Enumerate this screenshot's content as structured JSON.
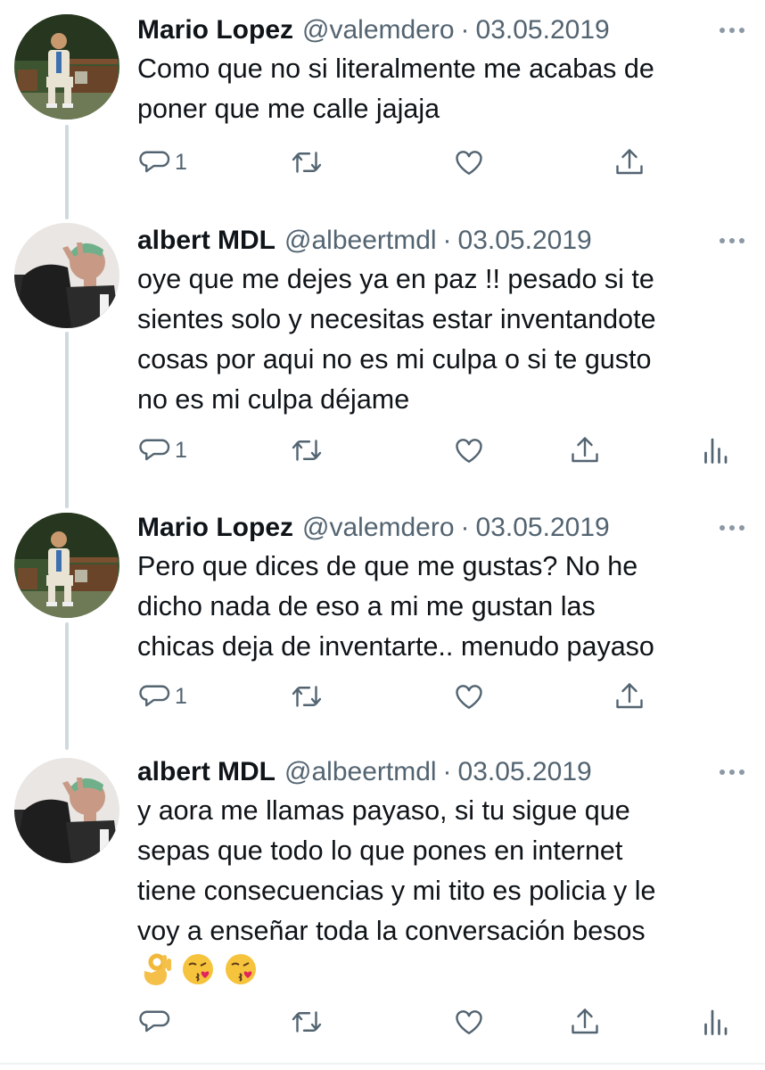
{
  "tweets": [
    {
      "name": "Mario Lopez",
      "handle": "@valemdero",
      "separator": "·",
      "date": "03.05.2019",
      "lines": [
        "Como que no si literalmente me acabas de",
        "poner que me calle jajaja"
      ],
      "reply_count": "1",
      "avatar_icon": "avatar-man-on-bench"
    },
    {
      "name": "albert MDL",
      "handle": "@albeertmdl",
      "separator": "·",
      "date": "03.05.2019",
      "lines": [
        "oye que me dejes ya en paz !! pesado si te",
        "sientes solo y necesitas estar inventandote",
        "cosas por aqui no es mi culpa o si te gusto",
        "no es mi culpa déjame"
      ],
      "reply_count": "1",
      "avatar_icon": "avatar-person-green-hair"
    },
    {
      "name": "Mario Lopez",
      "handle": "@valemdero",
      "separator": "·",
      "date": "03.05.2019",
      "lines": [
        "Pero que dices de que me gustas? No he",
        "dicho nada de eso a mi me gustan las",
        "chicas deja de inventarte.. menudo payaso"
      ],
      "reply_count": "1",
      "avatar_icon": "avatar-man-on-bench"
    },
    {
      "name": "albert MDL",
      "handle": "@albeertmdl",
      "separator": "·",
      "date": "03.05.2019",
      "lines": [
        "y aora me llamas payaso, si tu sigue que",
        "sepas que todo lo que pones en internet",
        "tiene consecuencias y mi tito es policia y le",
        "voy a enseñar toda la conversación besos"
      ],
      "emojis": [
        "👌",
        "😘",
        "😘"
      ],
      "reply_count": "",
      "avatar_icon": "avatar-person-green-hair"
    }
  ],
  "icons": {
    "more": "more-horizontal-icon",
    "reply": "reply-icon",
    "retweet": "retweet-icon",
    "like": "heart-icon",
    "share": "share-icon",
    "stats": "analytics-icon"
  },
  "colors": {
    "text": "#0f1419",
    "secondary": "#536471",
    "thread_line": "#cfd9de"
  }
}
